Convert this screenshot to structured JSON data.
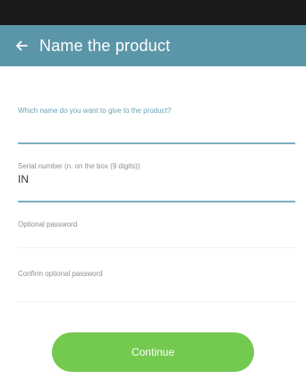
{
  "header": {
    "title": "Name the product",
    "back_icon": "arrow-left-icon"
  },
  "form": {
    "product_name": {
      "label": "Which name do you want to give to the product?",
      "value": ""
    },
    "serial_number": {
      "label": "Serial number (n. on the box (9 digits))",
      "value": "IN"
    },
    "password": {
      "label": "Optional password",
      "value": ""
    },
    "confirm_password": {
      "label": "Confirm optional password",
      "value": ""
    }
  },
  "actions": {
    "continue_label": "Continue"
  },
  "colors": {
    "status_bar": "#1a1a1a",
    "app_bar": "#5b95a8",
    "accent": "#6aa2b6",
    "button": "#74c94f"
  }
}
